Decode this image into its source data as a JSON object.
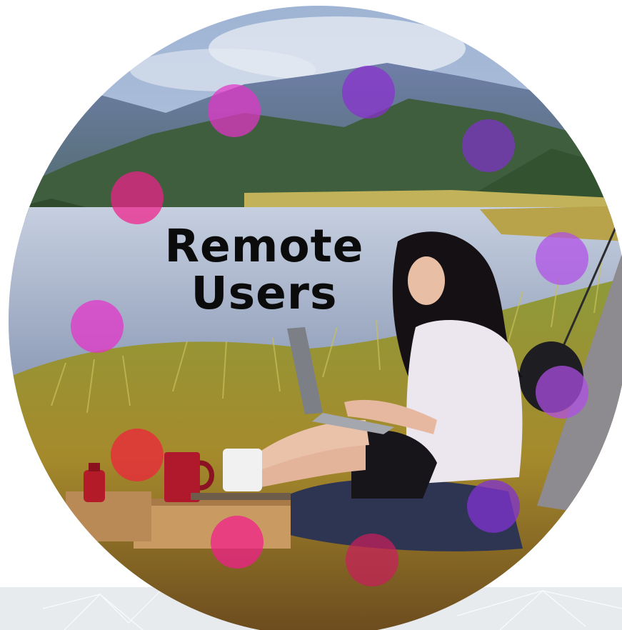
{
  "title": {
    "line1": "Remote",
    "line2": "Users"
  },
  "colors": {
    "dot_magenta": "#e334c8",
    "dot_pink": "#f0208a",
    "dot_purple": "#8a2fd0",
    "dot_violet": "#b04de8",
    "band": "#e7ebee"
  }
}
